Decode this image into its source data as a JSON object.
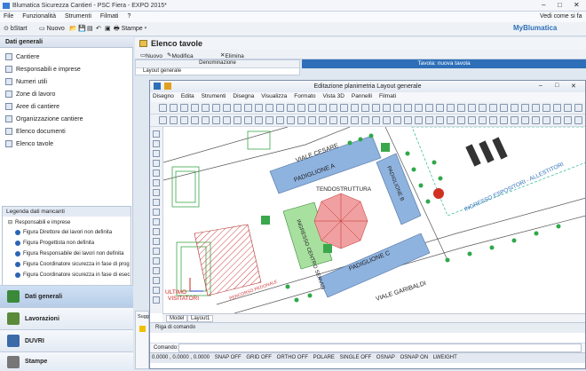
{
  "app": {
    "title": "Blumatica Sicurezza Cantieri - PSC Fiera - EXPO 2015*",
    "menu": [
      "File",
      "Funzionalità",
      "Strumenti",
      "Filmati",
      "?"
    ],
    "help_label": "Vedi come si fa",
    "toolbar": {
      "start": "bStart",
      "new": "Nuovo",
      "print": "Stampe"
    },
    "brand": "MyBlumatica"
  },
  "sidebar": {
    "header": "Dati generali",
    "items": [
      {
        "label": "Cantiere"
      },
      {
        "label": "Responsabili e imprese"
      },
      {
        "label": "Numeri utili"
      },
      {
        "label": "Zone di lavoro"
      },
      {
        "label": "Aree di cantiere"
      },
      {
        "label": "Organizzazione cantiere"
      },
      {
        "label": "Elenco documenti"
      },
      {
        "label": "Elenco tavole"
      }
    ],
    "legend": {
      "title": "Legenda dati mancanti",
      "group": "Responsabili e imprese",
      "rows": [
        "Figura Direttore dei lavori non definita",
        "Figura Progettista non definita",
        "Figura Responsabile dei lavori non definita",
        "Figura Coordinatore sicurezza in fase di prog",
        "Figura Coordinatore sicurezza in fase di esec"
      ]
    },
    "nav": [
      {
        "label": "Dati generali",
        "active": true
      },
      {
        "label": "Lavorazioni",
        "active": false
      },
      {
        "label": "DUVRI",
        "active": false
      },
      {
        "label": "Stampe",
        "active": false
      }
    ],
    "sugg": "Sugg"
  },
  "panel": {
    "title": "Elenco tavole",
    "tools": [
      "Nuovo",
      "Modifica tavola",
      "Elimina"
    ],
    "column_header": "Denominazione",
    "row": "Layout generale",
    "tavola_header": "Tavola: nuova tavola"
  },
  "drawing": {
    "title": "Editazione planimetria Layout generale",
    "menu": [
      "Disegno",
      "Edita",
      "Strumenti",
      "Disegna",
      "Visualizza",
      "Formato",
      "Vista 3D",
      "Pannelli",
      "Filmati"
    ],
    "labels": {
      "viale_cesare": "VIALE CESARE",
      "padiglione_a": "PADIGLIONE A",
      "padiglione_b": "PADIGLIONE B",
      "padiglione_c": "PADIGLIONE C",
      "tendostruttura": "TENDOSTRUTTURA",
      "ingresso_servizi": "INGRESSO CENTRO SERVIZI",
      "viale_garibaldi": "VIALE GARIBALDI",
      "ingresso_espositori": "INGRESSO ESPOSITORI - ALLESTITORI",
      "percorso": "PERCORSO PEDONALE",
      "visitatori": "VISITATORI",
      "ultimo": "ULTIMO"
    },
    "tabs": [
      "Model",
      "Layout1"
    ],
    "cmd_header": "Riga di comando",
    "cmd_label": "Comando:",
    "status": [
      "0.0000 , 0.0000 , 0.0000",
      "SNAP OFF",
      "GRID OFF",
      "ORTHO OFF",
      "POLARE",
      "SINGLE OFF",
      "OSNAP",
      "OSNAP ON",
      "LWEIGHT"
    ]
  },
  "colors": {
    "accent": "#2d6fb8",
    "building": "#8fb3df",
    "green_area": "#a8e0a0",
    "hatch": "#d04040"
  }
}
